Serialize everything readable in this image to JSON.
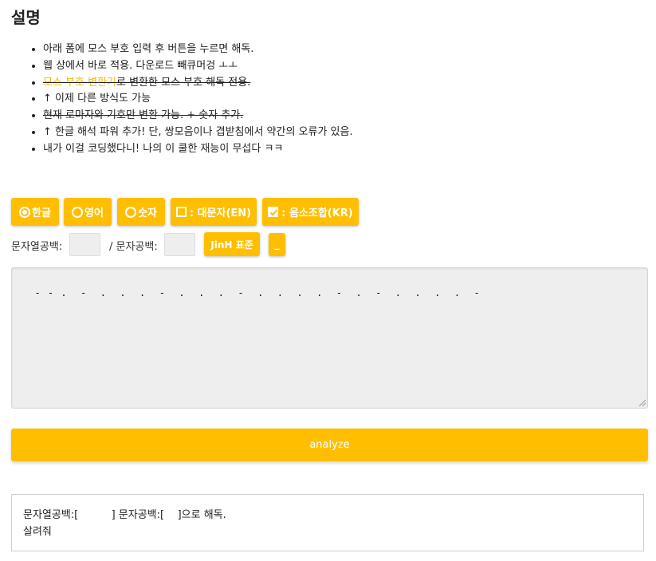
{
  "heading": "설명",
  "description": {
    "line1": "아래 폼에 모스 부호 입력 후 버튼을 누르면 해독.",
    "line2": "웹 상에서 바로 적용. 다운로드 빼큐머겅 ㅗㅗ",
    "line3_link": "모스 부호 변환기",
    "line3_rest": "로 변환한 모스 부호 해독 전용.",
    "line4": "↑ 이제 다른 방식도 가능",
    "line5": "현재 로마자와 기호만 변환 가능. + 숫자 추가.",
    "line6": "↑ 한글 해석 파워 추가! 단, 쌍모음이나 겹받침에서 약간의 오류가 있음.",
    "line7": "내가 이걸 코딩했다니! 나의 이 쿨한 재능이 무섭다 ㅋㅋ"
  },
  "options": {
    "korean": "한글",
    "english": "영어",
    "number": "숫자",
    "uppercase": ": 대문자(EN)",
    "phoneme": ": 음소조합(KR)"
  },
  "spacing": {
    "string_space_label": "문자열공백:",
    "char_space_label": "/ 문자공백:",
    "string_space_value": "",
    "char_space_value": "",
    "jinh_button": "JinH 표준",
    "underscore_button": "_"
  },
  "morse_input": "- - .  -  .  .  .  -  .  .  .  -  .  .  .  .  -  .  -  .  .  .  .  -",
  "analyze_button": "analyze",
  "result": {
    "line1": "문자열공백:[          ] 문자공백:[    ]으로 해독.",
    "line2": "살려줘"
  },
  "colors": {
    "accent": "#ffbf00",
    "struck_link": "#f6b800"
  }
}
